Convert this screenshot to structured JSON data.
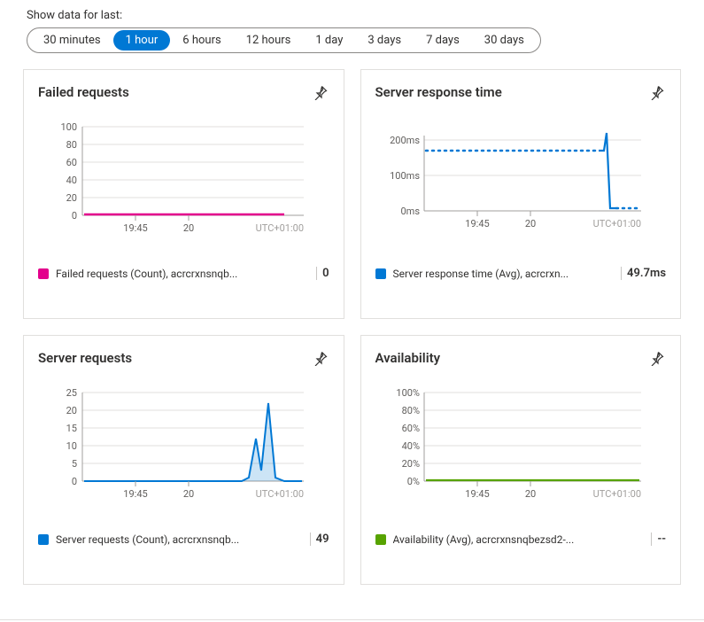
{
  "time_range": {
    "label": "Show data for last:",
    "options": [
      "30 minutes",
      "1 hour",
      "6 hours",
      "12 hours",
      "1 day",
      "3 days",
      "7 days",
      "30 days"
    ],
    "selected_index": 1
  },
  "colors": {
    "blue": "#0078d4",
    "magenta": "#e3008c",
    "green": "#57a300",
    "axis_grey": "#a19f9d",
    "grid_grey": "#e1dfdd"
  },
  "cards": [
    {
      "id": "failed-requests",
      "title": "Failed requests",
      "legend_label": "Failed requests (Count), acrcrxnsnqb...",
      "legend_value": "0",
      "legend_color": "#e3008c",
      "timezone": "UTC+01:00",
      "x_ticks": [
        "19:45",
        "20"
      ]
    },
    {
      "id": "server-response-time",
      "title": "Server response time",
      "legend_label": "Server response time (Avg), acrcrxn...",
      "legend_value": "49.7ms",
      "legend_color": "#0078d4",
      "timezone": "UTC+01:00",
      "x_ticks": [
        "19:45",
        "20"
      ]
    },
    {
      "id": "server-requests",
      "title": "Server requests",
      "legend_label": "Server requests (Count), acrcrxnsnqb...",
      "legend_value": "49",
      "legend_color": "#0078d4",
      "timezone": "UTC+01:00",
      "x_ticks": [
        "19:45",
        "20"
      ]
    },
    {
      "id": "availability",
      "title": "Availability",
      "legend_label": "Availability (Avg), acrcrxnsnqbezsd2-...",
      "legend_value": "--",
      "legend_color": "#57a300",
      "timezone": "UTC+01:00",
      "x_ticks": [
        "19:45",
        "20"
      ]
    }
  ],
  "chart_data": [
    {
      "id": "failed-requests",
      "type": "line",
      "title": "Failed requests",
      "xlabel": "",
      "ylabel": "",
      "ylim": [
        0,
        100
      ],
      "y_ticks": [
        0,
        20,
        40,
        60,
        80,
        100
      ],
      "x_ticks": [
        "19:45",
        "20"
      ],
      "timezone": "UTC+01:00",
      "series": [
        {
          "name": "Failed requests (Count), acrcrxnsnqb...",
          "color": "#e3008c",
          "x": [
            "19:30",
            "19:35",
            "19:40",
            "19:45",
            "19:50",
            "19:55",
            "20:00",
            "20:05",
            "20:10",
            "20:15",
            "20:20",
            "20:25",
            "20:30"
          ],
          "values": [
            0,
            0,
            0,
            0,
            0,
            0,
            0,
            0,
            0,
            0,
            0,
            0,
            0
          ]
        }
      ]
    },
    {
      "id": "server-response-time",
      "type": "line",
      "title": "Server response time",
      "xlabel": "",
      "ylabel": "",
      "ylim": [
        0,
        220
      ],
      "y_ticks_labels": [
        "0ms",
        "100ms",
        "200ms"
      ],
      "y_ticks": [
        0,
        100,
        200
      ],
      "x_ticks": [
        "19:45",
        "20"
      ],
      "timezone": "UTC+01:00",
      "series": [
        {
          "name": "Server response time (Avg), acrcrxn...",
          "color": "#0078d4",
          "style": "dotted-on-gaps",
          "x": [
            "19:30",
            "19:35",
            "19:40",
            "19:45",
            "19:50",
            "19:55",
            "20:00",
            "20:05",
            "20:10",
            "20:15",
            "20:20",
            "20:22",
            "20:23",
            "20:25",
            "20:30"
          ],
          "values": [
            170,
            170,
            170,
            170,
            170,
            170,
            170,
            170,
            170,
            170,
            170,
            210,
            10,
            10,
            10
          ],
          "measured_mask": [
            false,
            false,
            false,
            false,
            false,
            false,
            false,
            false,
            false,
            false,
            true,
            true,
            true,
            false,
            false
          ]
        }
      ]
    },
    {
      "id": "server-requests",
      "type": "area",
      "title": "Server requests",
      "xlabel": "",
      "ylabel": "",
      "ylim": [
        0,
        25
      ],
      "y_ticks": [
        0,
        5,
        10,
        15,
        20,
        25
      ],
      "x_ticks": [
        "19:45",
        "20"
      ],
      "timezone": "UTC+01:00",
      "series": [
        {
          "name": "Server requests (Count), acrcrxnsnqb...",
          "color": "#0078d4",
          "x": [
            "19:30",
            "19:35",
            "19:40",
            "19:45",
            "19:50",
            "19:55",
            "20:00",
            "20:05",
            "20:10",
            "20:15",
            "20:17",
            "20:19",
            "20:21",
            "20:23",
            "20:25",
            "20:28",
            "20:30"
          ],
          "values": [
            0,
            0,
            0,
            0,
            0,
            0,
            0,
            0,
            0,
            0,
            1,
            12,
            3,
            22,
            1,
            0,
            0
          ]
        }
      ]
    },
    {
      "id": "availability",
      "type": "line",
      "title": "Availability",
      "xlabel": "",
      "ylabel": "",
      "ylim": [
        0,
        100
      ],
      "y_ticks_labels": [
        "0%",
        "20%",
        "40%",
        "60%",
        "80%",
        "100%"
      ],
      "y_ticks": [
        0,
        20,
        40,
        60,
        80,
        100
      ],
      "x_ticks": [
        "19:45",
        "20"
      ],
      "timezone": "UTC+01:00",
      "series": [
        {
          "name": "Availability (Avg), acrcrxnsnqbezsd2-...",
          "color": "#57a300",
          "x": [
            "19:30",
            "20:30"
          ],
          "values": [
            0,
            0
          ]
        }
      ]
    }
  ]
}
